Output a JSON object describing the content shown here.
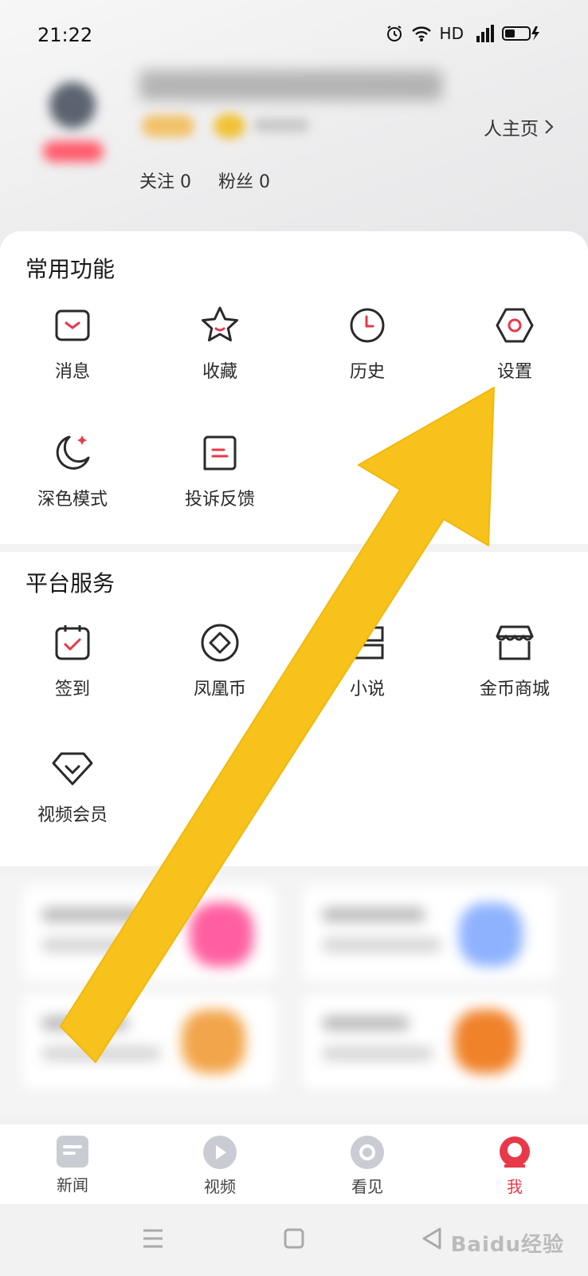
{
  "status_bar": {
    "time": "21:22",
    "network": "HD"
  },
  "profile": {
    "home_link": "人主页",
    "following_label": "关注",
    "following_count": "0",
    "fans_label": "粉丝",
    "fans_count": "0"
  },
  "common": {
    "title": "常用功能",
    "items": [
      {
        "label": "消息",
        "icon": "message-icon"
      },
      {
        "label": "收藏",
        "icon": "star-icon"
      },
      {
        "label": "历史",
        "icon": "clock-icon"
      },
      {
        "label": "设置",
        "icon": "settings-icon"
      },
      {
        "label": "深色模式",
        "icon": "moon-icon"
      },
      {
        "label": "投诉反馈",
        "icon": "feedback-icon"
      }
    ]
  },
  "platform": {
    "title": "平台服务",
    "items": [
      {
        "label": "签到",
        "icon": "checkin-icon"
      },
      {
        "label": "凤凰币",
        "icon": "coin-icon"
      },
      {
        "label": "小说",
        "icon": "book-icon"
      },
      {
        "label": "金币商城",
        "icon": "store-icon"
      },
      {
        "label": "视频会员",
        "icon": "vip-icon"
      }
    ]
  },
  "tabs": [
    {
      "label": "新闻",
      "icon": "news-icon"
    },
    {
      "label": "视频",
      "icon": "video-icon"
    },
    {
      "label": "看见",
      "icon": "see-icon"
    },
    {
      "label": "我",
      "icon": "me-icon",
      "active": true
    }
  ],
  "colors": {
    "accent": "#e8394a",
    "arrow": "#f8c21c"
  },
  "watermark": "Baidu经验"
}
